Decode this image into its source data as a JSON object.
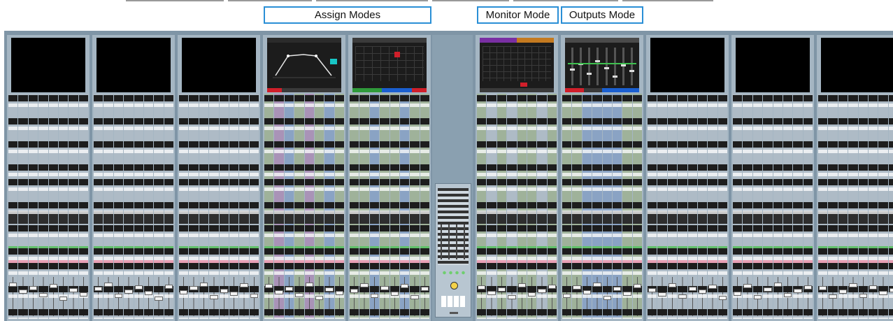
{
  "header": {
    "assign_modes_label": "Assign Modes",
    "monitor_mode_label": "Monitor Mode",
    "outputs_mode_label": "Outputs Mode"
  },
  "console": {
    "bays": [
      {
        "id": "bay-1",
        "screen": "blank"
      },
      {
        "id": "bay-2",
        "screen": "blank"
      },
      {
        "id": "bay-3",
        "screen": "blank"
      },
      {
        "id": "bay-4",
        "screen": "eq-curve"
      },
      {
        "id": "bay-5",
        "screen": "channel-routing"
      },
      {
        "id": "bay-6",
        "screen": "monitor"
      },
      {
        "id": "bay-7",
        "screen": "outputs"
      },
      {
        "id": "bay-8",
        "screen": "blank"
      },
      {
        "id": "bay-9",
        "screen": "blank"
      },
      {
        "id": "bay-10",
        "screen": "blank"
      }
    ],
    "strips_per_bay": 8
  },
  "colors": {
    "mode_border": "#2a8fd6",
    "desk_frame": "#7f95a6",
    "bay_surface": "#a5b6c3",
    "accent_green": "#62c06a",
    "accent_pink": "#e8a0b5",
    "accent_blue": "#1a5fd0",
    "accent_red": "#d01f2a",
    "accent_purple": "#7a2fa3",
    "accent_orange": "#c47a20"
  }
}
